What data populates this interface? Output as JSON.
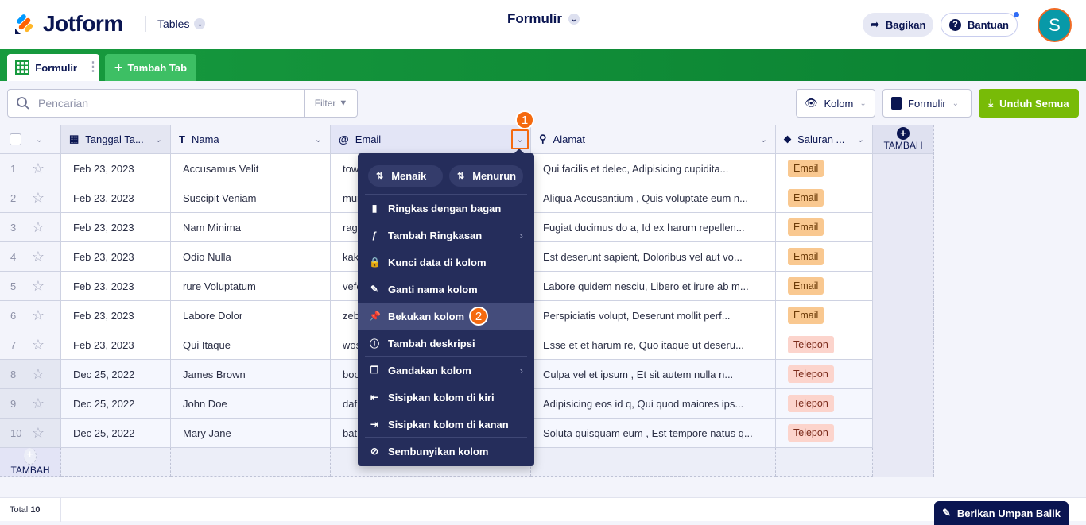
{
  "header": {
    "logo": "Jotform",
    "product": "Tables",
    "title": "Formulir",
    "share": "Bagikan",
    "help": "Bantuan",
    "avatar": "S"
  },
  "tabs": [
    {
      "label": "Formulir"
    },
    {
      "label": "Tambah Tab"
    }
  ],
  "toolbar": {
    "search_placeholder": "Pencarian",
    "filter": "Filter",
    "columns": "Kolom",
    "form": "Formulir",
    "download": "Unduh Semua"
  },
  "columns": [
    "Tanggal Ta...",
    "Nama",
    "Email",
    "Alamat",
    "Saluran ..."
  ],
  "add_label": "TAMBAH",
  "rows": [
    {
      "n": "1",
      "date": "Feb 23, 2023",
      "name": "Accusamus Velit",
      "email": "tow",
      "addr": "Qui facilis et delec, Adipisicing cupidita...",
      "ch": "Email"
    },
    {
      "n": "2",
      "date": "Feb 23, 2023",
      "name": "Suscipit Veniam",
      "email": "mur",
      "addr": "Aliqua Accusantium , Quis voluptate eum n...",
      "ch": "Email"
    },
    {
      "n": "3",
      "date": "Feb 23, 2023",
      "name": "Nam Minima",
      "email": "rage",
      "addr": "Fugiat ducimus do a, Id ex harum repellen...",
      "ch": "Email"
    },
    {
      "n": "4",
      "date": "Feb 23, 2023",
      "name": "Odio Nulla",
      "email": "kak",
      "addr": "Est deserunt sapient, Doloribus vel aut vo...",
      "ch": "Email"
    },
    {
      "n": "5",
      "date": "Feb 23, 2023",
      "name": "rure Voluptatum",
      "email": "vefo",
      "addr": "Labore quidem nesciu, Libero et irure ab m...",
      "ch": "Email"
    },
    {
      "n": "6",
      "date": "Feb 23, 2023",
      "name": "Labore Dolor",
      "email": "zeb",
      "addr": "Perspiciatis volupt, Deserunt mollit perf...",
      "ch": "Email"
    },
    {
      "n": "7",
      "date": "Feb 23, 2023",
      "name": "Qui Itaque",
      "email": "wos",
      "addr": "Esse et et harum re, Quo itaque ut deseru...",
      "ch": "Telepon"
    },
    {
      "n": "8",
      "date": "Dec 25, 2022",
      "name": "James Brown",
      "email": "boo",
      "addr": "Culpa vel et ipsum , Et sit autem nulla n...",
      "ch": "Telepon"
    },
    {
      "n": "9",
      "date": "Dec 25, 2022",
      "name": "John Doe",
      "email": "daf",
      "addr": "Adipisicing eos id q, Qui quod maiores ips...",
      "ch": "Telepon"
    },
    {
      "n": "10",
      "date": "Dec 25, 2022",
      "name": "Mary Jane",
      "email": "bati",
      "addr": "Soluta quisquam eum , Est tempore natus q...",
      "ch": "Telepon"
    }
  ],
  "menu": {
    "asc": "Menaik",
    "desc": "Menurun",
    "items": [
      "Ringkas dengan bagan",
      "Tambah Ringkasan",
      "Kunci data di kolom",
      "Ganti nama kolom",
      "Bekukan kolom",
      "Tambah deskripsi",
      "Gandakan kolom",
      "Sisipkan kolom di kiri",
      "Sisipkan kolom di kanan",
      "Sembunyikan kolom"
    ]
  },
  "steps": [
    "1",
    "2"
  ],
  "footer": {
    "total_label": "Total",
    "total": "10",
    "feedback": "Berikan Umpan Balik"
  },
  "colors": {
    "green": "#0a8132",
    "accent": "#78bb07",
    "orange": "#f56a0f",
    "menu": "#252d5b"
  }
}
